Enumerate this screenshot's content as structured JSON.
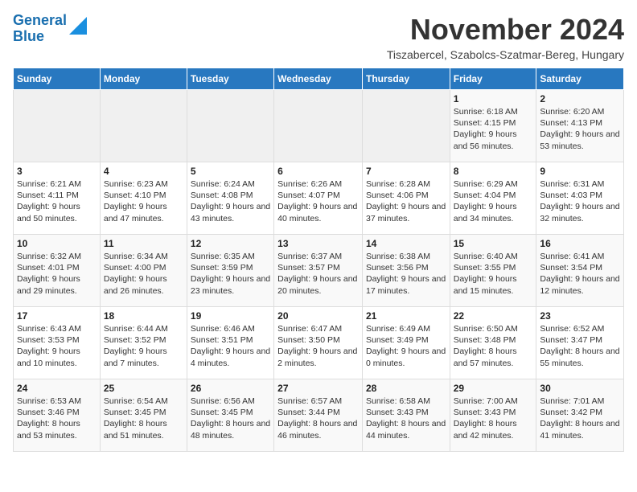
{
  "header": {
    "logo_line1": "General",
    "logo_line2": "Blue",
    "month_title": "November 2024",
    "subtitle": "Tiszabercel, Szabolcs-Szatmar-Bereg, Hungary"
  },
  "days_of_week": [
    "Sunday",
    "Monday",
    "Tuesday",
    "Wednesday",
    "Thursday",
    "Friday",
    "Saturday"
  ],
  "weeks": [
    [
      {
        "day": "",
        "info": ""
      },
      {
        "day": "",
        "info": ""
      },
      {
        "day": "",
        "info": ""
      },
      {
        "day": "",
        "info": ""
      },
      {
        "day": "",
        "info": ""
      },
      {
        "day": "1",
        "info": "Sunrise: 6:18 AM\nSunset: 4:15 PM\nDaylight: 9 hours and 56 minutes."
      },
      {
        "day": "2",
        "info": "Sunrise: 6:20 AM\nSunset: 4:13 PM\nDaylight: 9 hours and 53 minutes."
      }
    ],
    [
      {
        "day": "3",
        "info": "Sunrise: 6:21 AM\nSunset: 4:11 PM\nDaylight: 9 hours and 50 minutes."
      },
      {
        "day": "4",
        "info": "Sunrise: 6:23 AM\nSunset: 4:10 PM\nDaylight: 9 hours and 47 minutes."
      },
      {
        "day": "5",
        "info": "Sunrise: 6:24 AM\nSunset: 4:08 PM\nDaylight: 9 hours and 43 minutes."
      },
      {
        "day": "6",
        "info": "Sunrise: 6:26 AM\nSunset: 4:07 PM\nDaylight: 9 hours and 40 minutes."
      },
      {
        "day": "7",
        "info": "Sunrise: 6:28 AM\nSunset: 4:06 PM\nDaylight: 9 hours and 37 minutes."
      },
      {
        "day": "8",
        "info": "Sunrise: 6:29 AM\nSunset: 4:04 PM\nDaylight: 9 hours and 34 minutes."
      },
      {
        "day": "9",
        "info": "Sunrise: 6:31 AM\nSunset: 4:03 PM\nDaylight: 9 hours and 32 minutes."
      }
    ],
    [
      {
        "day": "10",
        "info": "Sunrise: 6:32 AM\nSunset: 4:01 PM\nDaylight: 9 hours and 29 minutes."
      },
      {
        "day": "11",
        "info": "Sunrise: 6:34 AM\nSunset: 4:00 PM\nDaylight: 9 hours and 26 minutes."
      },
      {
        "day": "12",
        "info": "Sunrise: 6:35 AM\nSunset: 3:59 PM\nDaylight: 9 hours and 23 minutes."
      },
      {
        "day": "13",
        "info": "Sunrise: 6:37 AM\nSunset: 3:57 PM\nDaylight: 9 hours and 20 minutes."
      },
      {
        "day": "14",
        "info": "Sunrise: 6:38 AM\nSunset: 3:56 PM\nDaylight: 9 hours and 17 minutes."
      },
      {
        "day": "15",
        "info": "Sunrise: 6:40 AM\nSunset: 3:55 PM\nDaylight: 9 hours and 15 minutes."
      },
      {
        "day": "16",
        "info": "Sunrise: 6:41 AM\nSunset: 3:54 PM\nDaylight: 9 hours and 12 minutes."
      }
    ],
    [
      {
        "day": "17",
        "info": "Sunrise: 6:43 AM\nSunset: 3:53 PM\nDaylight: 9 hours and 10 minutes."
      },
      {
        "day": "18",
        "info": "Sunrise: 6:44 AM\nSunset: 3:52 PM\nDaylight: 9 hours and 7 minutes."
      },
      {
        "day": "19",
        "info": "Sunrise: 6:46 AM\nSunset: 3:51 PM\nDaylight: 9 hours and 4 minutes."
      },
      {
        "day": "20",
        "info": "Sunrise: 6:47 AM\nSunset: 3:50 PM\nDaylight: 9 hours and 2 minutes."
      },
      {
        "day": "21",
        "info": "Sunrise: 6:49 AM\nSunset: 3:49 PM\nDaylight: 9 hours and 0 minutes."
      },
      {
        "day": "22",
        "info": "Sunrise: 6:50 AM\nSunset: 3:48 PM\nDaylight: 8 hours and 57 minutes."
      },
      {
        "day": "23",
        "info": "Sunrise: 6:52 AM\nSunset: 3:47 PM\nDaylight: 8 hours and 55 minutes."
      }
    ],
    [
      {
        "day": "24",
        "info": "Sunrise: 6:53 AM\nSunset: 3:46 PM\nDaylight: 8 hours and 53 minutes."
      },
      {
        "day": "25",
        "info": "Sunrise: 6:54 AM\nSunset: 3:45 PM\nDaylight: 8 hours and 51 minutes."
      },
      {
        "day": "26",
        "info": "Sunrise: 6:56 AM\nSunset: 3:45 PM\nDaylight: 8 hours and 48 minutes."
      },
      {
        "day": "27",
        "info": "Sunrise: 6:57 AM\nSunset: 3:44 PM\nDaylight: 8 hours and 46 minutes."
      },
      {
        "day": "28",
        "info": "Sunrise: 6:58 AM\nSunset: 3:43 PM\nDaylight: 8 hours and 44 minutes."
      },
      {
        "day": "29",
        "info": "Sunrise: 7:00 AM\nSunset: 3:43 PM\nDaylight: 8 hours and 42 minutes."
      },
      {
        "day": "30",
        "info": "Sunrise: 7:01 AM\nSunset: 3:42 PM\nDaylight: 8 hours and 41 minutes."
      }
    ]
  ]
}
